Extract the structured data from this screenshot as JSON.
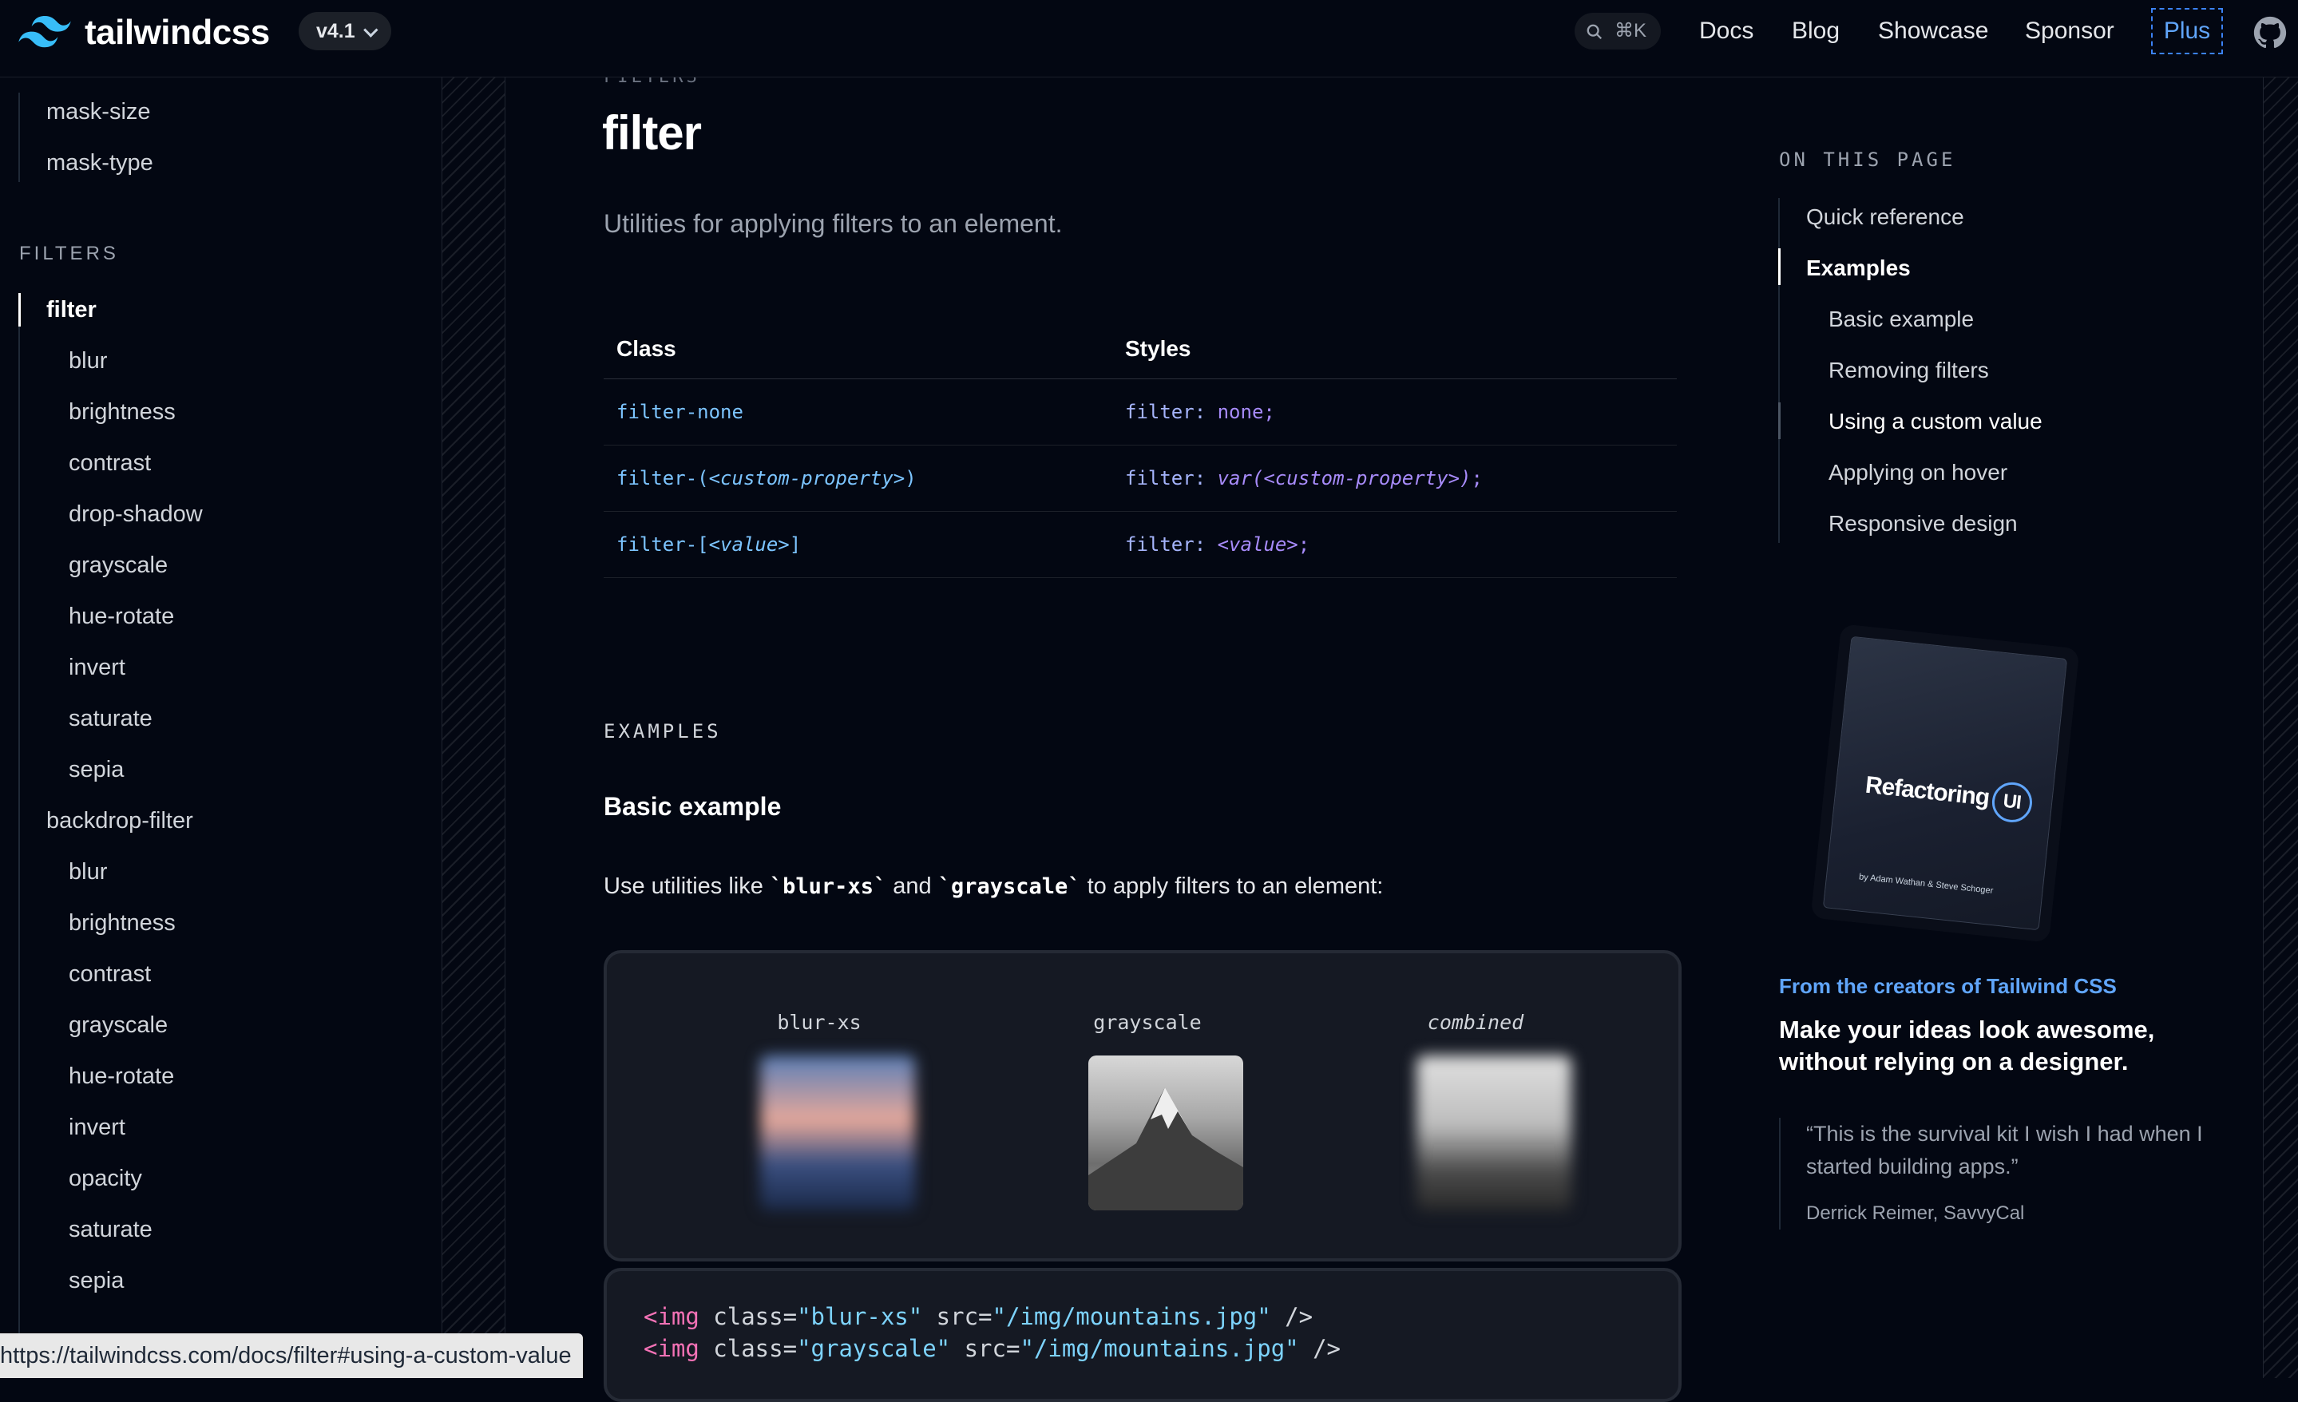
{
  "header": {
    "logo_text": "tailwindcss",
    "version": "v4.1",
    "search_shortcut": "⌘K",
    "nav": [
      "Docs",
      "Blog",
      "Showcase",
      "Sponsor",
      "Plus"
    ]
  },
  "sidebar": {
    "top_items": [
      "mask-size",
      "mask-type"
    ],
    "section_title": "FILTERS",
    "items": [
      {
        "label": "filter",
        "level": 1,
        "active": true
      },
      {
        "label": "blur",
        "level": 2
      },
      {
        "label": "brightness",
        "level": 2
      },
      {
        "label": "contrast",
        "level": 2
      },
      {
        "label": "drop-shadow",
        "level": 2
      },
      {
        "label": "grayscale",
        "level": 2
      },
      {
        "label": "hue-rotate",
        "level": 2
      },
      {
        "label": "invert",
        "level": 2
      },
      {
        "label": "saturate",
        "level": 2
      },
      {
        "label": "sepia",
        "level": 2
      },
      {
        "label": "backdrop-filter",
        "level": 1
      },
      {
        "label": "blur",
        "level": 2
      },
      {
        "label": "brightness",
        "level": 2
      },
      {
        "label": "contrast",
        "level": 2
      },
      {
        "label": "grayscale",
        "level": 2
      },
      {
        "label": "hue-rotate",
        "level": 2
      },
      {
        "label": "invert",
        "level": 2
      },
      {
        "label": "opacity",
        "level": 2
      },
      {
        "label": "saturate",
        "level": 2
      },
      {
        "label": "sepia",
        "level": 2
      }
    ]
  },
  "main": {
    "eyebrow": "FILTERS",
    "title": "filter",
    "description": "Utilities for applying filters to an element.",
    "table": {
      "headers": [
        "Class",
        "Styles"
      ],
      "rows": [
        {
          "cls_a": "filter-none",
          "cls_b": "",
          "cls_c": "",
          "sty_a": "filter: ",
          "sty_b": "none;",
          "sty_c": ""
        },
        {
          "cls_a": "filter-(",
          "cls_b": "<custom-property>",
          "cls_c": ")",
          "sty_a": "filter: ",
          "sty_b": "var(<custom-property>)",
          "sty_c": ";"
        },
        {
          "cls_a": "filter-[",
          "cls_b": "<value>",
          "cls_c": "]",
          "sty_a": "filter: ",
          "sty_b": "<value>",
          "sty_c": ";"
        }
      ]
    },
    "examples_eyebrow": "EXAMPLES",
    "example_heading": "Basic example",
    "example_desc_pre": "Use utilities like ",
    "example_code_1": "`blur-xs`",
    "example_desc_mid": " and ",
    "example_code_2": "`grayscale`",
    "example_desc_post": " to apply filters to an element:",
    "demos": [
      "blur-xs",
      "grayscale",
      "combined"
    ],
    "code_lines": [
      {
        "a": "<img",
        "b": " class=",
        "c": "\"blur-xs\"",
        "d": " src=",
        "e": "\"/img/mountains.jpg\"",
        "f": " />"
      },
      {
        "a": "<img",
        "b": " class=",
        "c": "\"grayscale\"",
        "d": " src=",
        "e": "\"/img/mountains.jpg\"",
        "f": " />"
      }
    ]
  },
  "on_this_page": {
    "title": "ON THIS PAGE",
    "items": [
      {
        "label": "Quick reference",
        "level": 1
      },
      {
        "label": "Examples",
        "level": 1,
        "active": true
      },
      {
        "label": "Basic example",
        "level": 2
      },
      {
        "label": "Removing filters",
        "level": 2
      },
      {
        "label": "Using a custom value",
        "level": 2,
        "hover": true
      },
      {
        "label": "Applying on hover",
        "level": 2
      },
      {
        "label": "Responsive design",
        "level": 2
      }
    ]
  },
  "promo": {
    "book_title": "Refactoring",
    "book_ui": "UI",
    "book_by": "by Adam Wathan & Steve Schoger",
    "eyebrow": "From the creators of Tailwind CSS",
    "headline": "Make your ideas look awesome, without relying on a designer.",
    "quote": "“This is the survival kit I wish I had when I started building apps.”",
    "author": "Derrick Reimer, SavvyCal"
  },
  "status_url": "https://tailwindcss.com/docs/filter#using-a-custom-value",
  "colors": {
    "background": "#030712",
    "accent": "#60a5fa",
    "code_class": "#7cc4ff",
    "code_style": "#a78bfa"
  }
}
